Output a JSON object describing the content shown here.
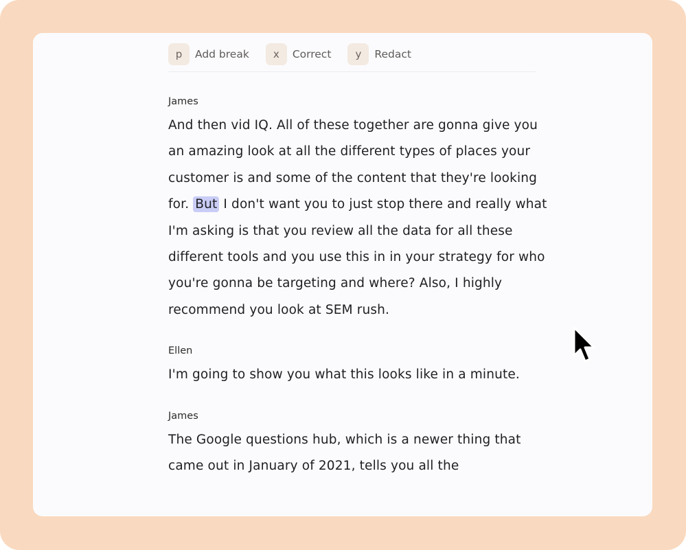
{
  "toolbar": {
    "items": [
      {
        "key": "p",
        "label": "Add break"
      },
      {
        "key": "x",
        "label": "Correct"
      },
      {
        "key": "y",
        "label": "Redact"
      }
    ]
  },
  "transcript": {
    "blocks": [
      {
        "speaker": "James",
        "text_before": "And then vid IQ. All of these together are gonna give you an amazing look at all the different types of places your customer is and some of the content that they're looking for. ",
        "highlight": "But",
        "text_after": " I don't want you to just stop there and really what I'm asking is that you review all the data for all these different tools and you use this in in your strategy for who you're gonna be targeting and where? Also, I highly recommend you look at SEM rush."
      },
      {
        "speaker": "Ellen",
        "text": "I'm going to show you what this looks like in a minute."
      },
      {
        "speaker": "James",
        "text": "The Google questions hub, which is a newer thing that came out in January of 2021, tells you all the"
      }
    ]
  },
  "colors": {
    "frame": "#f9d9bf",
    "card": "#fbfbfd",
    "highlight": "#c9cdf6",
    "key_bg": "#f3eae1"
  },
  "icons": {
    "pointer": "mouse-cursor-icon"
  }
}
